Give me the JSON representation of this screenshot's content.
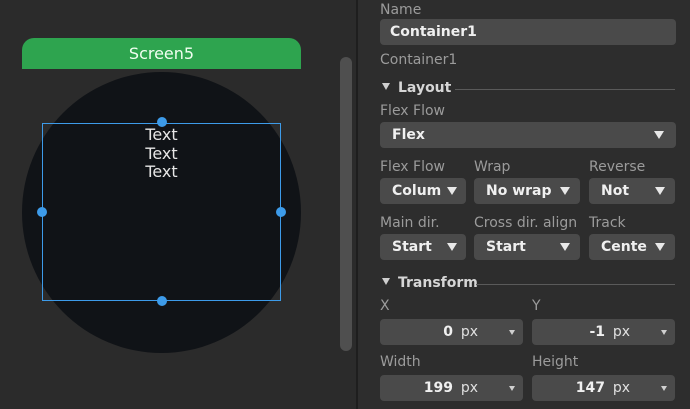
{
  "canvas": {
    "screen_tab_label": "Screen5",
    "text_lines": [
      "Text",
      "Text",
      "Text"
    ]
  },
  "properties": {
    "name_label": "Name",
    "name_value": "Container1",
    "type_caption": "Container1",
    "layout_section": "Layout",
    "flex_flow_label": "Flex Flow",
    "flex_flow_value": "Flex",
    "flex_flow2_label": "Flex Flow",
    "flex_flow2_value": "Colum",
    "wrap_label": "Wrap",
    "wrap_value": "No wrap",
    "reverse_label": "Reverse",
    "reverse_value": "Not",
    "main_dir_label": "Main dir.",
    "main_dir_value": "Start",
    "cross_dir_label": "Cross dir. align",
    "cross_dir_value": "Start",
    "track_label": "Track",
    "track_value": "Cente",
    "transform_section": "Transform",
    "x_label": "X",
    "x_value": "0",
    "x_unit": "px",
    "y_label": "Y",
    "y_value": "-1",
    "y_unit": "px",
    "width_label": "Width",
    "width_value": "199",
    "width_unit": "px",
    "height_label": "Height",
    "height_value": "147",
    "height_unit": "px"
  },
  "colors": {
    "screen_tab": "#2ea44f",
    "selection": "#3d9be9",
    "round_screen": "#101317",
    "panel_bg": "#2d2d2d",
    "field_bg": "#4a4a4a"
  },
  "icons": [
    "dropdown-caret-icon",
    "section-collapse-triangle-icon",
    "selection-handle-icon"
  ]
}
